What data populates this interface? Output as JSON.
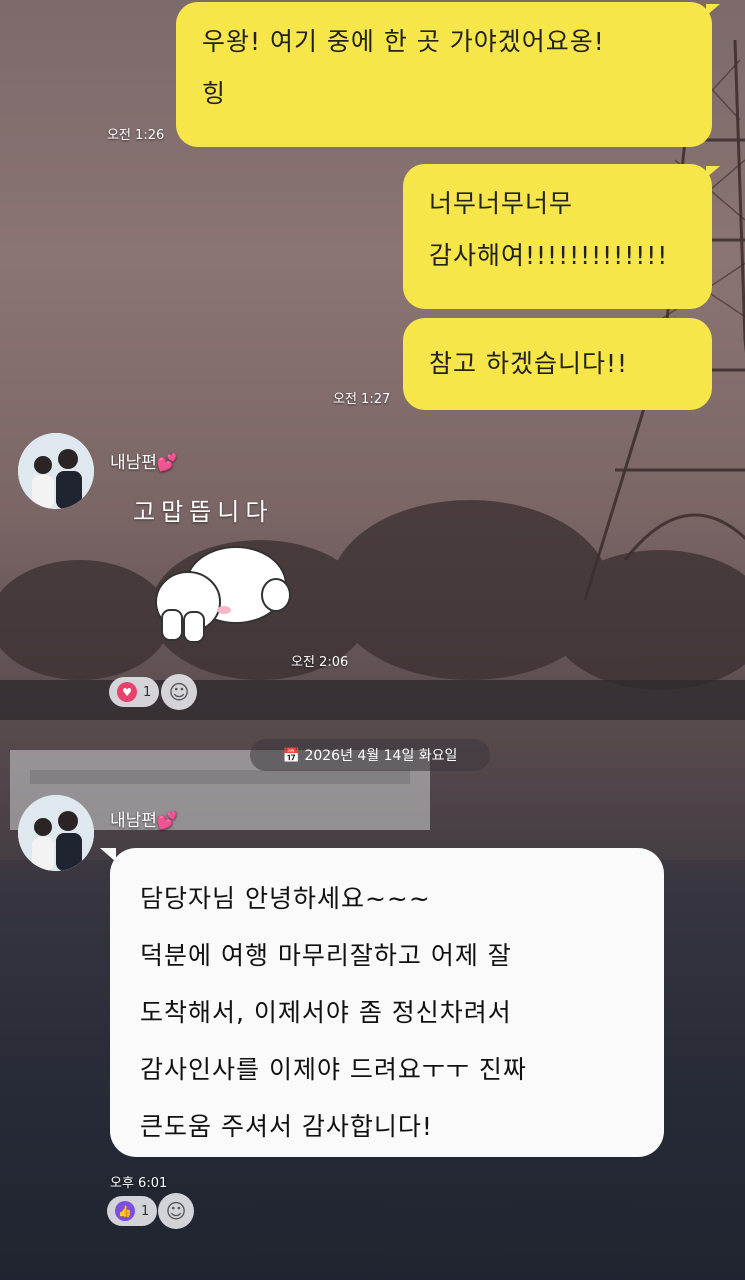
{
  "messages_me": [
    {
      "lines": [
        "우왕! 여기 중에 한 곳 가야겠어요옹!",
        "힝"
      ],
      "time": "오전 1:26"
    },
    {
      "lines": [
        "너무너무너무",
        "감사해여!!!!!!!!!!!!!"
      ]
    },
    {
      "lines": [
        "참고 하겠습니다!!"
      ],
      "time": "오전 1:27"
    }
  ],
  "sender_block_1": {
    "name": "내남편💕",
    "sticker_text": "고맙뜹니다",
    "time": "오전 2:06",
    "reaction_count": "1"
  },
  "date_divider": "📅 2026년 4월 14일 화요일",
  "sender_block_2": {
    "name": "내남편💕",
    "lines": [
      "담당자님 안녕하세요~~~",
      "덕분에 여행 마무리잘하고 어제 잘",
      "도착해서, 이제서야 좀 정신차려서",
      "감사인사를 이제야 드려요ㅜㅜ 진짜",
      "큰도움 주셔서 감사합니다!"
    ],
    "time": "오후 6:01",
    "reaction_count": "1"
  },
  "colors": {
    "my_bubble": "#f6e64a",
    "their_bubble": "#fafafa",
    "heart": "#e8426a",
    "thumb": "#7b4ee0"
  }
}
